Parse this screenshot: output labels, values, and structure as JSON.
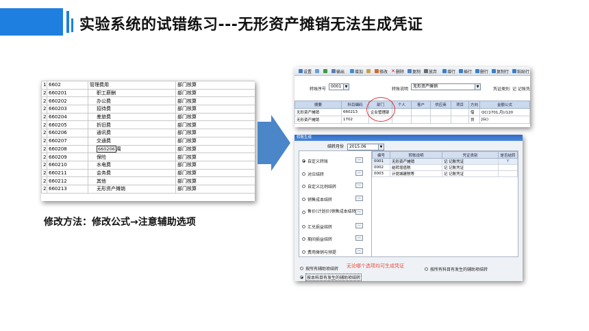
{
  "header": {
    "title": "实验系统的试错练习---无形资产摊销无法生成凭证"
  },
  "sheet": {
    "rows": [
      {
        "level": "1",
        "code": "6602",
        "name": "管理费用",
        "dept": "部门核算",
        "indent": false
      },
      {
        "level": "2",
        "code": "660201",
        "name": "职工薪酬",
        "dept": "部门核算",
        "indent": true
      },
      {
        "level": "2",
        "code": "660202",
        "name": "办公费",
        "dept": "部门核算",
        "indent": true
      },
      {
        "level": "2",
        "code": "660203",
        "name": "招待费",
        "dept": "部门核算",
        "indent": true
      },
      {
        "level": "2",
        "code": "660204",
        "name": "差旅费",
        "dept": "部门核算",
        "indent": true
      },
      {
        "level": "2",
        "code": "660205",
        "name": "折旧费",
        "dept": "部门核算",
        "indent": true
      },
      {
        "level": "2",
        "code": "660206",
        "name": "通讯费",
        "dept": "部门核算",
        "indent": true
      },
      {
        "level": "2",
        "code": "660207",
        "name": "交通费",
        "dept": "部门核算",
        "indent": true
      },
      {
        "level": "2",
        "code": "660208",
        "name": "周",
        "dept": "部门核算",
        "indent": true,
        "edit": "660206"
      },
      {
        "level": "2",
        "code": "660209",
        "name": "保险",
        "dept": "部门核算",
        "indent": true
      },
      {
        "level": "2",
        "code": "660210",
        "name": "水电费",
        "dept": "部门核算",
        "indent": true
      },
      {
        "level": "2",
        "code": "660211",
        "name": "会务费",
        "dept": "部门核算",
        "indent": true
      },
      {
        "level": "2",
        "code": "660212",
        "name": "其他",
        "dept": "部门核算",
        "indent": true
      },
      {
        "level": "2",
        "code": "660213",
        "name": "无形资产摊销",
        "dept": "部门核算",
        "indent": true
      }
    ]
  },
  "method_text": "修改方法：修改公式→注意辅助选项",
  "winA": {
    "toolbar": [
      "设置",
      "",
      "",
      "输出",
      "增加",
      "",
      "修改",
      "删除",
      "复制",
      "放弃",
      "增行",
      "插行",
      "删行",
      "复制行",
      "粘贴行"
    ],
    "form": {
      "seq_label": "转账序号",
      "seq_value": "0001",
      "desc_label": "转账说明",
      "desc_value": "无形资产摊销",
      "voucher_label": "凭证类别",
      "voucher_value": "记 记账凭证"
    },
    "columns": [
      "摘要",
      "科目编码",
      "部门",
      "个人",
      "客户",
      "供应商",
      "项目",
      "方向",
      "金额公式"
    ],
    "rows": [
      [
        "无形资产摊销",
        "660213",
        "企业管理部",
        "",
        "",
        "",
        "",
        "借",
        "QC(1701,月)/120"
      ],
      [
        "无形资产摊销",
        "1702",
        "",
        "",
        "",
        "",
        "",
        "贷",
        "JG()"
      ]
    ]
  },
  "winB": {
    "title": "转账生成",
    "period_label": "结转月份",
    "period_value": "2015.06",
    "options": [
      {
        "label": "自定义转账",
        "checked": true
      },
      {
        "label": "对应结转",
        "checked": false
      },
      {
        "label": "自定义比例结转",
        "checked": false
      },
      {
        "label": "销售成本结转",
        "checked": false
      },
      {
        "label": "售价(计划价)销售成本结转",
        "checked": false
      },
      {
        "label": "汇兑损益结转",
        "checked": false
      },
      {
        "label": "期间损益结转",
        "checked": false
      },
      {
        "label": "费用摊销与预提",
        "checked": false
      }
    ],
    "dots_label": "...",
    "columns": [
      "编号",
      "转账说明",
      "凭证类别",
      "是否结转"
    ],
    "rows": [
      [
        "0001",
        "无形资产摊销",
        "记 记账凭证",
        "Y"
      ],
      [
        "0002",
        "结转增值税",
        "记 记账凭证",
        ""
      ],
      [
        "0003",
        "计提城建税等",
        "记 记账凭证",
        ""
      ]
    ],
    "bottom_options": [
      {
        "label": "按所有辅助项结转",
        "checked": false
      },
      {
        "label": "按所有科目有发生的辅助项结转",
        "checked": false
      },
      {
        "label": "按本科目有发生的辅助项结转",
        "checked": true
      }
    ],
    "note": "无论哪个选项均可生成凭证"
  },
  "colors": {
    "accent": "#1e7fe0",
    "arrow": "#4a86c8",
    "note": "#e84a3a",
    "circle": "#e23030"
  }
}
